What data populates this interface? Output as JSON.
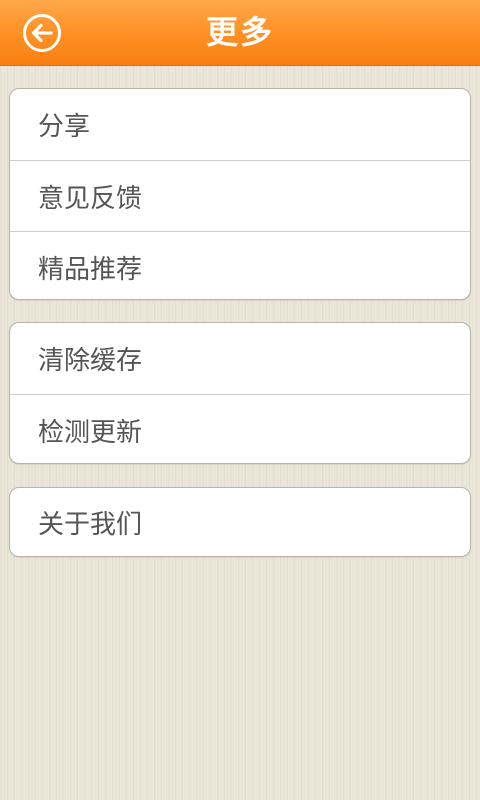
{
  "header": {
    "title": "更多",
    "back_icon": "back-arrow-circle-icon",
    "background_color": "#ff8f22"
  },
  "menu_groups": [
    {
      "items": [
        {
          "label": "分享"
        },
        {
          "label": "意见反馈"
        },
        {
          "label": "精品推荐"
        }
      ]
    },
    {
      "items": [
        {
          "label": "清除缓存"
        },
        {
          "label": "检测更新"
        }
      ]
    },
    {
      "items": [
        {
          "label": "关于我们"
        }
      ]
    }
  ]
}
